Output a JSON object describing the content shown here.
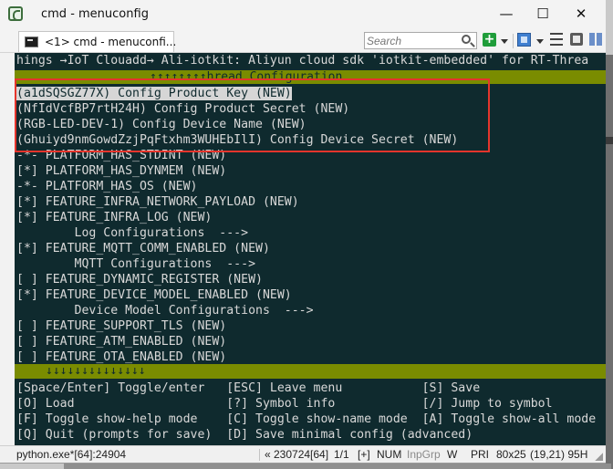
{
  "window": {
    "title": "cmd - menuconfig"
  },
  "controls": {
    "minimize": "—",
    "maximize": "☐",
    "close": "✕"
  },
  "tab": {
    "label": "<1> cmd - menuconfi..."
  },
  "search": {
    "placeholder": "Search"
  },
  "console": {
    "header": "hings →IoT Clouadd→ Ali-iotkit: Aliyun cloud sdk 'iotkit-embedded' for RT-Threa",
    "title": "↑↑↑↑↑↑↑↑hread Configuration",
    "items": [
      "(a1dSQSGZ77X) Config Product Key (NEW)",
      "(NfIdVcfBP7rtH24H) Config Product Secret (NEW)",
      "(RGB-LED-DEV-1) Config Device Name (NEW)",
      "(Ghuiyd9nmGowdZzjPqFtxhm3WUHEbIlI) Config Device Secret (NEW)",
      "-*- PLATFORM_HAS_STDINT (NEW)",
      "[*] PLATFORM_HAS_DYNMEM (NEW)",
      "-*- PLATFORM_HAS_OS (NEW)",
      "[*] FEATURE_INFRA_NETWORK_PAYLOAD (NEW)",
      "[*] FEATURE_INFRA_LOG (NEW)",
      "        Log Configurations  --->",
      "[*] FEATURE_MQTT_COMM_ENABLED (NEW)",
      "        MQTT Configurations  --->",
      "[ ] FEATURE_DYNAMIC_REGISTER (NEW)",
      "[*] FEATURE_DEVICE_MODEL_ENABLED (NEW)",
      "        Device Model Configurations  --->",
      "[ ] FEATURE_SUPPORT_TLS (NEW)",
      "[ ] FEATURE_ATM_ENABLED (NEW)",
      "[ ] FEATURE_OTA_ENABLED (NEW)"
    ],
    "bottom_arrows": "↓↓↓↓↓↓↓↓↓↓↓↓↓↓",
    "help": [
      "[Space/Enter] Toggle/enter   [ESC] Leave menu           [S] Save",
      "[O] Load                     [?] Symbol info            [/] Jump to symbol",
      "[F] Toggle show-help mode    [C] Toggle show-name mode  [A] Toggle show-all mode",
      "[Q] Quit (prompts for save)  [D] Save minimal config (advanced)"
    ]
  },
  "status": {
    "process": "python.exe*[64]:24904",
    "position": "« 230724[64]",
    "page": "1/1",
    "ins": "[+]",
    "num": "NUM",
    "inpgrp": "InpGrp",
    "w": "W",
    "pri": "PRI",
    "size": "80x25",
    "cursor": "(19,21) 95H"
  },
  "colors": {
    "console_bg": "#0f2a2e",
    "title_band": "#7a8c00",
    "highlight_box": "#e5352c",
    "selected_bg": "#d6d6d6"
  }
}
